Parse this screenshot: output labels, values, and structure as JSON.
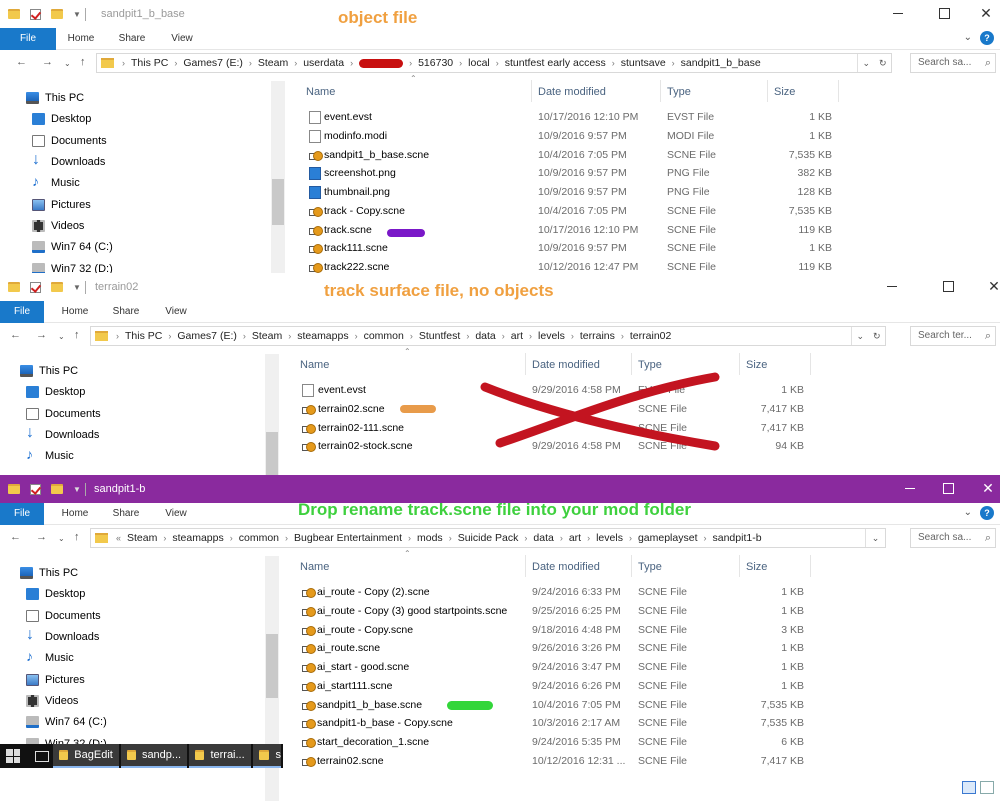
{
  "window1": {
    "title": "sandpit1_b_base",
    "annotation": "object file",
    "ribbon": {
      "file": "File",
      "home": "Home",
      "share": "Share",
      "view": "View"
    },
    "path": [
      "This PC",
      "Games7 (E:)",
      "Steam",
      "userdata",
      "516730",
      "local",
      "stuntfest early access",
      "stuntsave",
      "sandpit1_b_base"
    ],
    "search_placeholder": "Search sa...",
    "sidebar": [
      "This PC",
      "Desktop",
      "Documents",
      "Downloads",
      "Music",
      "Pictures",
      "Videos",
      "Win7 64 (C:)",
      "Win7 32 (D:)"
    ],
    "columns": {
      "name": "Name",
      "date": "Date modified",
      "type": "Type",
      "size": "Size"
    },
    "files": [
      {
        "name": "event.evst",
        "date": "10/17/2016 12:10 PM",
        "type": "EVST File",
        "size": "1 KB",
        "icon": "blank-file-icon"
      },
      {
        "name": "modinfo.modi",
        "date": "10/9/2016 9:57 PM",
        "type": "MODI File",
        "size": "1 KB",
        "icon": "blank-file-icon"
      },
      {
        "name": "sandpit1_b_base.scne",
        "date": "10/4/2016 7:05 PM",
        "type": "SCNE File",
        "size": "7,535 KB",
        "icon": "scne-file-icon"
      },
      {
        "name": "screenshot.png",
        "date": "10/9/2016 9:57 PM",
        "type": "PNG File",
        "size": "382 KB",
        "icon": "image-file-icon"
      },
      {
        "name": "thumbnail.png",
        "date": "10/9/2016 9:57 PM",
        "type": "PNG File",
        "size": "128 KB",
        "icon": "image-file-icon"
      },
      {
        "name": "track - Copy.scne",
        "date": "10/4/2016 7:05 PM",
        "type": "SCNE File",
        "size": "7,535 KB",
        "icon": "scne-file-icon"
      },
      {
        "name": "track.scne",
        "date": "10/17/2016 12:10 PM",
        "type": "SCNE File",
        "size": "119 KB",
        "icon": "scne-file-icon"
      },
      {
        "name": "track111.scne",
        "date": "10/9/2016 9:57 PM",
        "type": "SCNE File",
        "size": "1 KB",
        "icon": "scne-file-icon"
      },
      {
        "name": "track222.scne",
        "date": "10/12/2016 12:47 PM",
        "type": "SCNE File",
        "size": "119 KB",
        "icon": "scne-file-icon"
      }
    ]
  },
  "window2": {
    "title": "terrain02",
    "annotation": "track surface file, no objects",
    "ribbon": {
      "file": "File",
      "home": "Home",
      "share": "Share",
      "view": "View"
    },
    "path": [
      "This PC",
      "Games7 (E:)",
      "Steam",
      "steamapps",
      "common",
      "Stuntfest",
      "data",
      "art",
      "levels",
      "terrains",
      "terrain02"
    ],
    "search_placeholder": "Search ter...",
    "sidebar": [
      "This PC",
      "Desktop",
      "Documents",
      "Downloads",
      "Music"
    ],
    "columns": {
      "name": "Name",
      "date": "Date modified",
      "type": "Type",
      "size": "Size"
    },
    "files": [
      {
        "name": "event.evst",
        "date": "9/29/2016 4:58 PM",
        "type": "EVST File",
        "size": "1 KB",
        "icon": "blank-file-icon"
      },
      {
        "name": "terrain02.scne",
        "date": "",
        "type": "SCNE File",
        "size": "7,417 KB",
        "icon": "scne-file-icon"
      },
      {
        "name": "terrain02-111.scne",
        "date": "",
        "type": "SCNE File",
        "size": "7,417 KB",
        "icon": "scne-file-icon"
      },
      {
        "name": "terrain02-stock.scne",
        "date": "9/29/2016 4:58 PM",
        "type": "SCNE File",
        "size": "94 KB",
        "icon": "scne-file-icon"
      }
    ]
  },
  "window3": {
    "title": "sandpit1-b",
    "annotation": "Drop rename track.scne file into your mod folder",
    "ribbon": {
      "file": "File",
      "home": "Home",
      "share": "Share",
      "view": "View"
    },
    "path": [
      "Steam",
      "steamapps",
      "common",
      "Bugbear Entertainment",
      "mods",
      "Suicide Pack",
      "data",
      "art",
      "levels",
      "gameplayset",
      "sandpit1-b"
    ],
    "path_prefix": "«",
    "search_placeholder": "Search sa...",
    "sidebar": [
      "This PC",
      "Desktop",
      "Documents",
      "Downloads",
      "Music",
      "Pictures",
      "Videos",
      "Win7 64 (C:)",
      "Win7 32 (D:)"
    ],
    "columns": {
      "name": "Name",
      "date": "Date modified",
      "type": "Type",
      "size": "Size"
    },
    "files": [
      {
        "name": "ai_route - Copy (2).scne",
        "date": "9/24/2016 6:33 PM",
        "type": "SCNE File",
        "size": "1 KB",
        "icon": "scne-file-icon"
      },
      {
        "name": "ai_route - Copy (3) good startpoints.scne",
        "date": "9/25/2016 6:25 PM",
        "type": "SCNE File",
        "size": "1 KB",
        "icon": "scne-file-icon"
      },
      {
        "name": "ai_route - Copy.scne",
        "date": "9/18/2016 4:48 PM",
        "type": "SCNE File",
        "size": "3 KB",
        "icon": "scne-file-icon"
      },
      {
        "name": "ai_route.scne",
        "date": "9/26/2016 3:26 PM",
        "type": "SCNE File",
        "size": "1 KB",
        "icon": "scne-file-icon"
      },
      {
        "name": "ai_start - good.scne",
        "date": "9/24/2016 3:47 PM",
        "type": "SCNE File",
        "size": "1 KB",
        "icon": "scne-file-icon"
      },
      {
        "name": "ai_start111.scne",
        "date": "9/24/2016 6:26 PM",
        "type": "SCNE File",
        "size": "1 KB",
        "icon": "scne-file-icon"
      },
      {
        "name": "sandpit1_b_base.scne",
        "date": "10/4/2016 7:05 PM",
        "type": "SCNE File",
        "size": "7,535 KB",
        "icon": "scne-file-icon"
      },
      {
        "name": "sandpit1-b_base - Copy.scne",
        "date": "10/3/2016 2:17 AM",
        "type": "SCNE File",
        "size": "7,535 KB",
        "icon": "scne-file-icon"
      },
      {
        "name": "start_decoration_1.scne",
        "date": "9/24/2016 5:35 PM",
        "type": "SCNE File",
        "size": "6 KB",
        "icon": "scne-file-icon"
      },
      {
        "name": "terrain02.scne",
        "date": "10/12/2016 12:31 ...",
        "type": "SCNE File",
        "size": "7,417 KB",
        "icon": "scne-file-icon"
      }
    ]
  },
  "taskbar": {
    "items": [
      "BagEdit",
      "sandp...",
      "terrai...",
      "s"
    ]
  },
  "colors": {
    "accent": "#1979ca",
    "title_purple": "#8a2a9e",
    "annotation_orange": "#f0a040",
    "annotation_green": "#3ed03e",
    "redact_red": "#c81010",
    "marker_purple": "#7a18c8",
    "marker_orange": "#e89b4a",
    "marker_green": "#33d63a"
  }
}
